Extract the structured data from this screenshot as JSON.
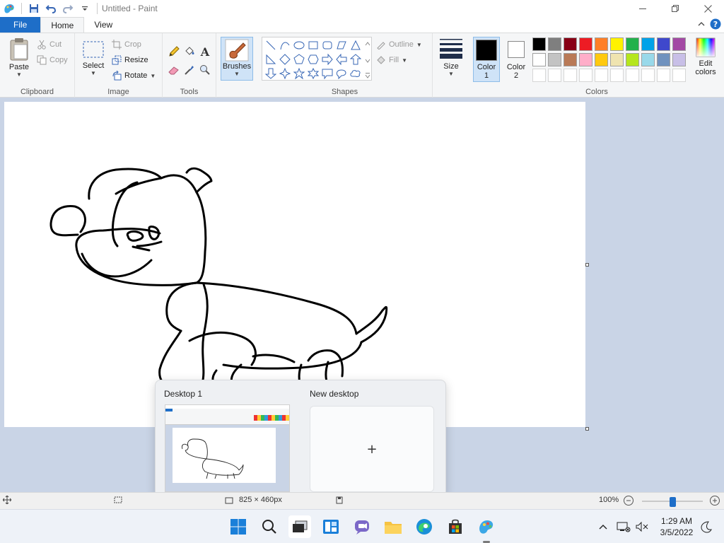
{
  "window": {
    "title": "Untitled - Paint"
  },
  "tabs": {
    "file": "File",
    "home": "Home",
    "view": "View"
  },
  "ribbon": {
    "clipboard": {
      "label": "Clipboard",
      "paste": "Paste",
      "cut": "Cut",
      "copy": "Copy"
    },
    "image": {
      "label": "Image",
      "select": "Select",
      "crop": "Crop",
      "resize": "Resize",
      "rotate": "Rotate"
    },
    "tools": {
      "label": "Tools"
    },
    "brushes": {
      "label": "Brushes"
    },
    "shapes": {
      "label": "Shapes",
      "outline": "Outline",
      "fill": "Fill"
    },
    "size": {
      "label": "Size"
    },
    "colors": {
      "label": "Colors",
      "color1_line1": "Color",
      "color1_line2": "1",
      "color2_line1": "Color",
      "color2_line2": "2",
      "edit_line1": "Edit",
      "edit_line2": "colors",
      "color1_value": "#000000",
      "color2_value": "#ffffff",
      "palette_row1": [
        "#000000",
        "#7f7f7f",
        "#880015",
        "#ed1c24",
        "#ff7f27",
        "#fff200",
        "#22b14c",
        "#00a2e8",
        "#3f48cc",
        "#a349a4"
      ],
      "palette_row2": [
        "#ffffff",
        "#c3c3c3",
        "#b97a57",
        "#ffaec9",
        "#ffc90e",
        "#efe4b0",
        "#b5e61d",
        "#99d9ea",
        "#7092be",
        "#c8bfe7"
      ]
    }
  },
  "taskview": {
    "desktop1": "Desktop 1",
    "new_desktop": "New desktop",
    "add_symbol": "+"
  },
  "statusbar": {
    "canvas_size": "825 × 460px",
    "zoom": "100%",
    "zoom_fraction": 0.5
  },
  "taskbar": {
    "time": "1:29 AM",
    "date": "3/5/2022"
  }
}
